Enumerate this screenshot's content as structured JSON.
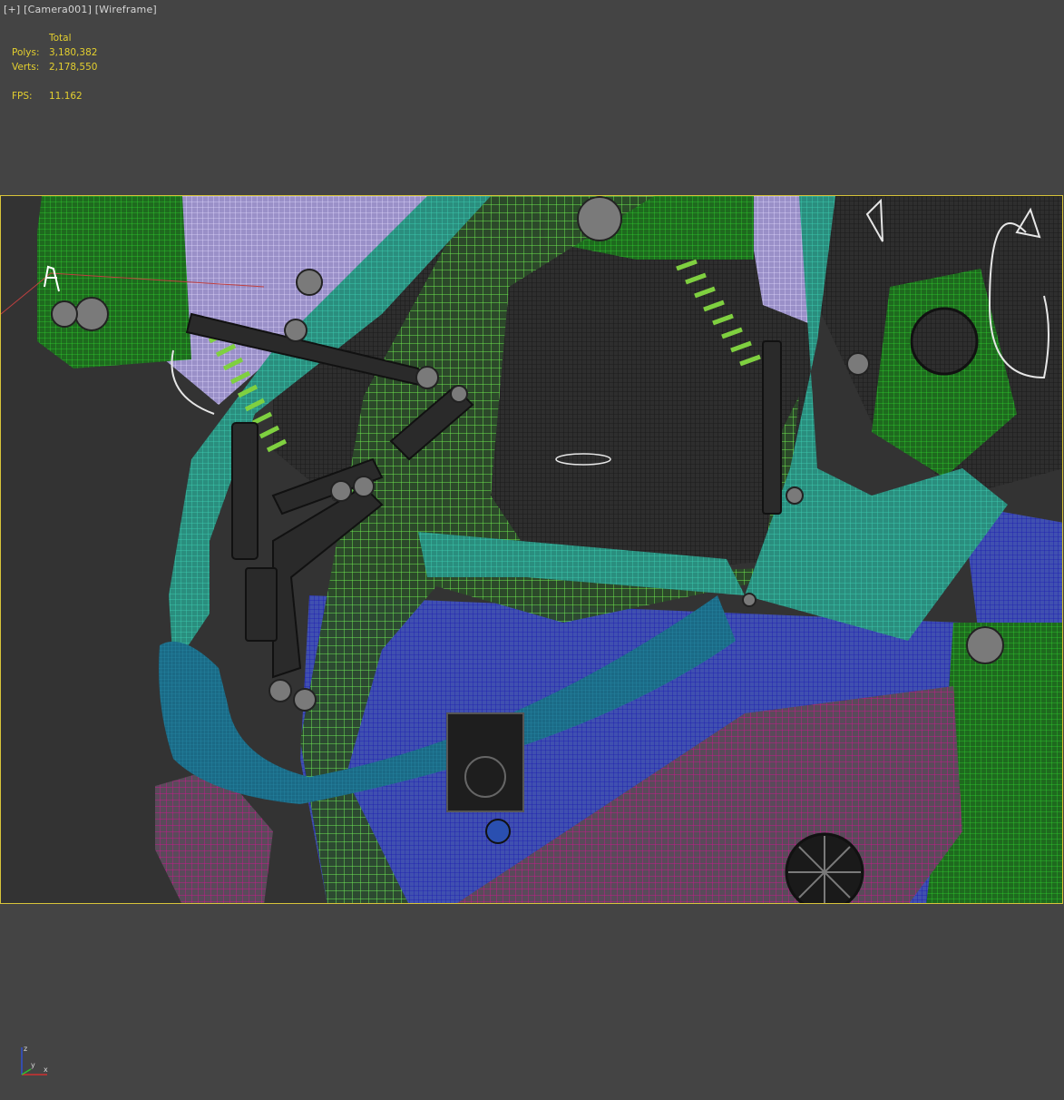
{
  "viewport": {
    "menu_plus": "[+]",
    "camera": "[Camera001]",
    "shading": "[Wireframe]"
  },
  "stats": {
    "header": "Total",
    "polys_label": "Polys:",
    "polys_value": "3,180,382",
    "verts_label": "Verts:",
    "verts_value": "2,178,550",
    "fps_label": "FPS:",
    "fps_value": "11.162"
  },
  "gizmo": {
    "z_label": "z",
    "x_label": "x",
    "y_label": "y"
  },
  "colors": {
    "background": "#444444",
    "safe_frame": "#d8c43a",
    "stats_text": "#e3cf2f",
    "wire_green": "#6ff050",
    "wire_teal": "#2fc2a4",
    "wire_blue": "#2a2ac0",
    "wire_lavender": "#c6b8f0",
    "wire_magenta": "#c41a8a",
    "wire_cyan": "#1f7c96",
    "wire_dark_green": "#1fa21f",
    "wire_black": "#1a1a1a"
  }
}
